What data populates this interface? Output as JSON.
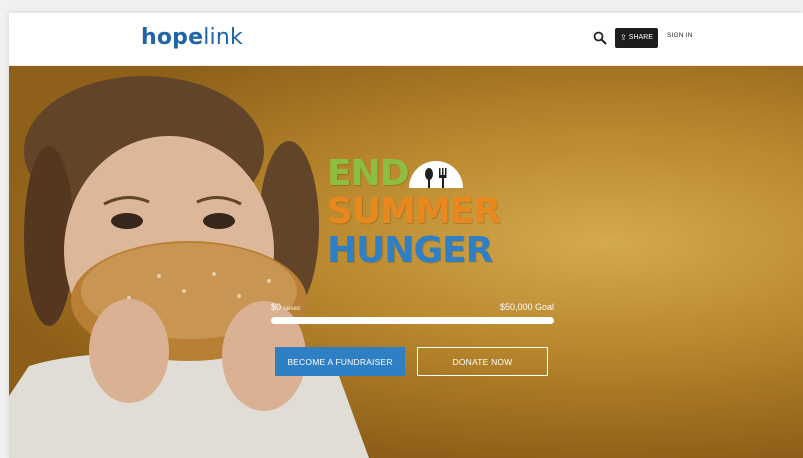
{
  "header": {
    "logo_bold": "hope",
    "logo_light": "link",
    "search_icon": "search-icon",
    "share_label": "SHARE",
    "share_icon": "share-icon",
    "signin_label": "SIGN IN"
  },
  "hero": {
    "campaign": {
      "line1": "END",
      "line2": "SUMMER",
      "line3": "HUNGER",
      "icon": "plate-fork-spoon-icon"
    },
    "progress": {
      "raised": "$0",
      "raised_sub": "raised",
      "goal": "$50,000 Goal",
      "fraction": 0
    },
    "buttons": {
      "fundraiser": "BECOME A FUNDRAISER",
      "donate": "DONATE NOW"
    }
  },
  "colors": {
    "brand_blue": "#1f65a8",
    "green": "#8cbf3f",
    "orange": "#e8881e",
    "blue": "#2f7fc4"
  }
}
